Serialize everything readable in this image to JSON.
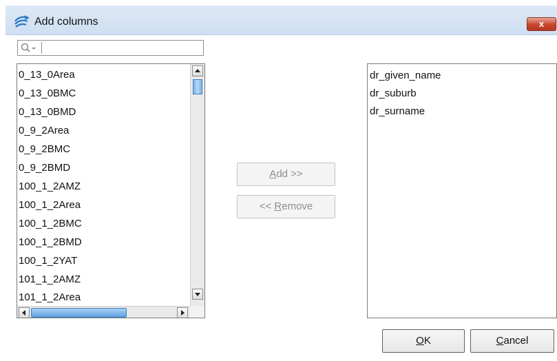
{
  "window": {
    "title": "Add columns",
    "close_label": "x"
  },
  "search": {
    "value": "",
    "placeholder": ""
  },
  "available_columns": {
    "items": [
      "0_13_0Area",
      "0_13_0BMC",
      "0_13_0BMD",
      "0_9_2Area",
      "0_9_2BMC",
      "0_9_2BMD",
      "100_1_2AMZ",
      "100_1_2Area",
      "100_1_2BMC",
      "100_1_2BMD",
      "100_1_2YAT",
      "101_1_2AMZ",
      "101_1_2Area"
    ]
  },
  "buttons": {
    "add": {
      "pre": "",
      "mnemonic": "A",
      "post": "dd >>"
    },
    "remove": {
      "pre": "<< ",
      "mnemonic": "R",
      "post": "emove"
    },
    "ok": {
      "pre": "",
      "mnemonic": "O",
      "post": "K"
    },
    "cancel": {
      "pre": "",
      "mnemonic": "C",
      "post": "ancel"
    }
  },
  "selected_columns": {
    "items": [
      "dr_given_name",
      "dr_suburb",
      "dr_surname"
    ]
  },
  "colors": {
    "title_bar": "#d6e4f5",
    "close_button": "#c7452d",
    "scroll_thumb": "#5fa0e0"
  },
  "icons": {
    "app": "app-logo-icon",
    "search": "search-icon",
    "close": "close-icon"
  }
}
